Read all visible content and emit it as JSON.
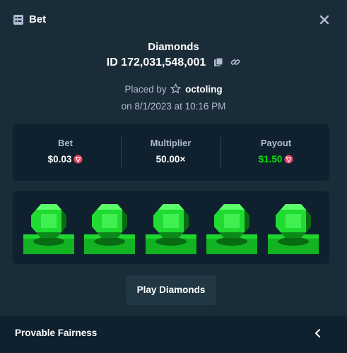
{
  "header": {
    "title": "Bet",
    "icon": "receipt-icon",
    "close_icon": "close-icon"
  },
  "bet": {
    "game": "Diamonds",
    "id_text": "ID 172,031,548,001",
    "copy_icon": "copy-icon",
    "link_icon": "link-icon",
    "placed_by_prefix": "Placed by",
    "username": "octoling",
    "user_icon": "star-icon",
    "date_text": "on 8/1/2023 at 10:16 PM"
  },
  "stats": {
    "bet_label": "Bet",
    "bet_value": "$0.03",
    "multiplier_label": "Multiplier",
    "multiplier_value": "50.00×",
    "payout_label": "Payout",
    "payout_value": "$1.50",
    "currency_icon": "tron-coin-icon"
  },
  "board": {
    "gems": [
      "green",
      "green",
      "green",
      "green",
      "green"
    ]
  },
  "play_button_label": "Play Diamonds",
  "footer": {
    "label": "Provable Fairness",
    "chevron_icon": "chevron-left-icon"
  },
  "colors": {
    "background": "#1a2c38",
    "panel": "#0f212e",
    "button": "#213743",
    "muted_text": "#b1bad3",
    "payout_green": "#00e701",
    "gem_green": "#1fdb32",
    "coin_red": "#ed4163"
  }
}
